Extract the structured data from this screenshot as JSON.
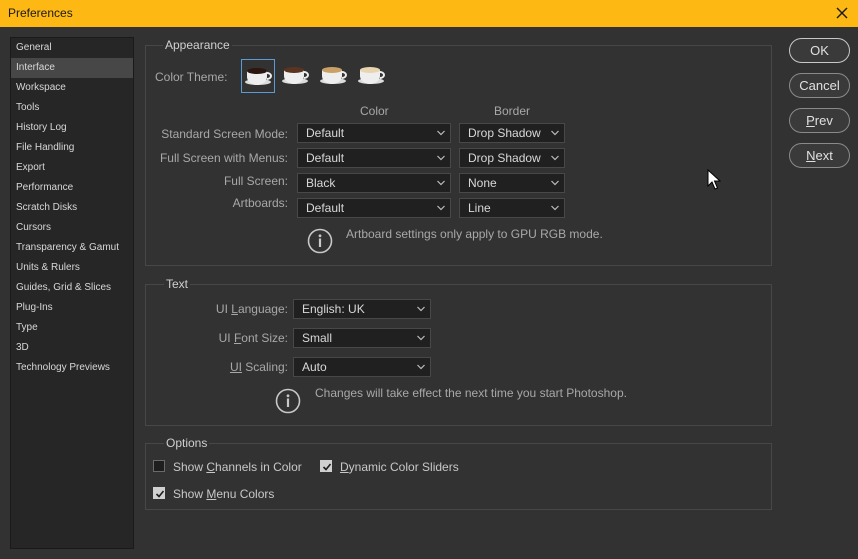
{
  "window": {
    "title": "Preferences"
  },
  "sidebar": {
    "items": [
      {
        "label": "General",
        "selected": false
      },
      {
        "label": "Interface",
        "selected": true
      },
      {
        "label": "Workspace",
        "selected": false
      },
      {
        "label": "Tools",
        "selected": false
      },
      {
        "label": "History Log",
        "selected": false
      },
      {
        "label": "File Handling",
        "selected": false
      },
      {
        "label": "Export",
        "selected": false
      },
      {
        "label": "Performance",
        "selected": false
      },
      {
        "label": "Scratch Disks",
        "selected": false
      },
      {
        "label": "Cursors",
        "selected": false
      },
      {
        "label": "Transparency & Gamut",
        "selected": false
      },
      {
        "label": "Units & Rulers",
        "selected": false
      },
      {
        "label": "Guides, Grid & Slices",
        "selected": false
      },
      {
        "label": "Plug-Ins",
        "selected": false
      },
      {
        "label": "Type",
        "selected": false
      },
      {
        "label": "3D",
        "selected": false
      },
      {
        "label": "Technology Previews",
        "selected": false
      }
    ]
  },
  "appearance": {
    "group_label": "Appearance",
    "color_theme_label": "Color Theme:",
    "themes": [
      {
        "name": "darkest",
        "selected": true
      },
      {
        "name": "dark",
        "selected": false
      },
      {
        "name": "medium",
        "selected": false
      },
      {
        "name": "light",
        "selected": false
      }
    ],
    "color_header": "Color",
    "border_header": "Border",
    "rows": [
      {
        "label": "Standard Screen Mode:",
        "color": "Default",
        "border": "Drop Shadow"
      },
      {
        "label": "Full Screen with Menus:",
        "color": "Default",
        "border": "Drop Shadow"
      },
      {
        "label": "Full Screen:",
        "color": "Black",
        "border": "None"
      },
      {
        "label": "Artboards:",
        "color": "Default",
        "border": "Line"
      }
    ],
    "note": "Artboard settings only apply to GPU RGB mode."
  },
  "text": {
    "group_label": "Text",
    "ui_language": {
      "prefix": "UI ",
      "mnemonic": "L",
      "suffix": "anguage:",
      "value": "English: UK"
    },
    "ui_font_size": {
      "prefix": "UI ",
      "mnemonic": "F",
      "suffix": "ont Size:",
      "value": "Small"
    },
    "ui_scaling": {
      "prefix": "",
      "mnemonic": "UI",
      "suffix": " Scaling:",
      "value": "Auto"
    },
    "note": "Changes will take effect the next time you start Photoshop."
  },
  "options": {
    "group_label": "Options",
    "show_channels": {
      "prefix": "Show ",
      "mnemonic": "C",
      "suffix": "hannels in Color",
      "checked": false
    },
    "dynamic_sliders": {
      "prefix": "",
      "mnemonic": "D",
      "suffix": "ynamic Color Sliders",
      "checked": true
    },
    "show_menu_colors": {
      "prefix": "Show ",
      "mnemonic": "M",
      "suffix": "enu Colors",
      "checked": true
    }
  },
  "buttons": {
    "ok": "OK",
    "cancel": "Cancel",
    "prev": {
      "mnemonic": "P",
      "rest": "rev"
    },
    "next": {
      "mnemonic": "N",
      "rest": "ext"
    }
  },
  "colors": {
    "titlebar": "#fdb813",
    "background": "#323232",
    "selection": "#474747",
    "accent": "#5b9bd5"
  }
}
